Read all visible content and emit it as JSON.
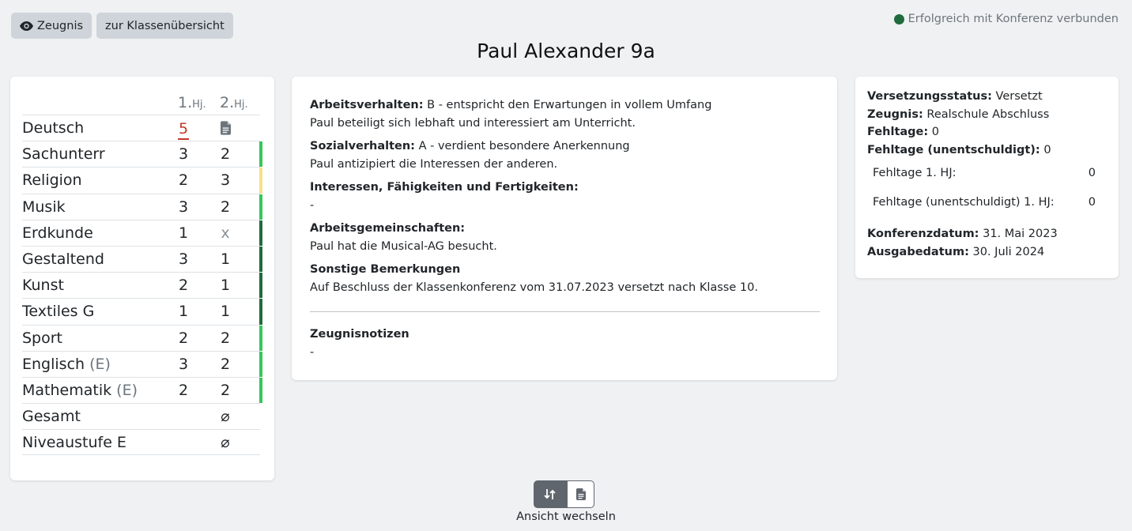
{
  "toolbar": {
    "report_label": "Zeugnis",
    "class_overview_label": "zur Klassenübersicht"
  },
  "connection_status": {
    "text": "Erfolgreich mit Konferenz verbunden",
    "color": "#1f6b3d"
  },
  "page_title": "Paul Alexander 9a",
  "grades": {
    "header": {
      "h1_num": "1.",
      "h1_suffix": "Hj.",
      "h2_num": "2.",
      "h2_suffix": "Hj."
    },
    "rows": [
      {
        "subject": "Deutsch",
        "level": "",
        "h1": "5",
        "h2": "",
        "h2_icon": "document-icon",
        "bar_color": ""
      },
      {
        "subject": "Sachunterr",
        "level": "",
        "h1": "3",
        "h2": "2",
        "bar_color": "#34c759"
      },
      {
        "subject": "Religion",
        "level": "",
        "h1": "2",
        "h2": "3",
        "bar_color": "#f7df8a"
      },
      {
        "subject": "Musik",
        "level": "",
        "h1": "3",
        "h2": "2",
        "bar_color": "#34c759"
      },
      {
        "subject": "Erdkunde",
        "level": "",
        "h1": "1",
        "h2": "x",
        "bar_color": "#1f6b3d"
      },
      {
        "subject": "Gestaltend",
        "level": "",
        "h1": "3",
        "h2": "1",
        "bar_color": "#1f6b3d"
      },
      {
        "subject": "Kunst",
        "level": "",
        "h1": "2",
        "h2": "1",
        "bar_color": "#1f6b3d"
      },
      {
        "subject": "Textiles G",
        "level": "",
        "h1": "1",
        "h2": "1",
        "bar_color": "#1f6b3d"
      },
      {
        "subject": "Sport",
        "level": "",
        "h1": "2",
        "h2": "2",
        "bar_color": "#34c759"
      },
      {
        "subject": "Englisch",
        "level": "(E)",
        "h1": "3",
        "h2": "2",
        "bar_color": "#34c759"
      },
      {
        "subject": "Mathematik",
        "level": "(E)",
        "h1": "2",
        "h2": "2",
        "bar_color": "#34c759"
      },
      {
        "subject": "Gesamt",
        "level": "",
        "h1": "",
        "h2": "⌀",
        "bar_color": ""
      },
      {
        "subject": "Niveaustufe E",
        "level": "",
        "h1": "",
        "h2": "⌀",
        "bar_color": ""
      }
    ]
  },
  "remarks": {
    "work_label": "Arbeitsverhalten:",
    "work_value": "B - entspricht den Erwartungen in vollem Umfang",
    "work_text": "Paul beteiligt sich lebhaft und interessiert am Unterricht.",
    "social_label": "Sozialverhalten:",
    "social_value": "A - verdient besondere Anerkennung",
    "social_text": "Paul antizipiert die Interessen der anderen.",
    "interests_label": "Interessen, Fähigkeiten und Fertigkeiten:",
    "interests_text": "-",
    "groups_label": "Arbeitsgemeinschaften:",
    "groups_text": "Paul hat die Musical-AG besucht.",
    "other_label": "Sonstige Bemerkungen",
    "other_text": "Auf Beschluss der Klassenkonferenz vom 31.07.2023 versetzt nach Klasse 10.",
    "notes_label": "Zeugnisnotizen",
    "notes_text": "-"
  },
  "info": {
    "promotion_label": "Versetzungsstatus:",
    "promotion_value": "Versetzt",
    "report_label": "Zeugnis:",
    "report_value": "Realschule Abschluss",
    "absent_label": "Fehltage:",
    "absent_value": "0",
    "unexcused_label": "Fehltage (unentschuldigt):",
    "unexcused_value": "0",
    "absent_h1_label": "Fehltage 1. HJ:",
    "absent_h1_value": "0",
    "unexcused_h1_label": "Fehltage (unentschuldigt) 1. HJ:",
    "unexcused_h1_value": "0",
    "conference_label": "Konferenzdatum:",
    "conference_value": "31. Mai 2023",
    "issue_label": "Ausgabedatum:",
    "issue_value": "30. Juli 2024"
  },
  "view_switch": {
    "label": "Ansicht wechseln",
    "left_icon": "sort-arrows-icon",
    "right_icon": "document-icon"
  }
}
